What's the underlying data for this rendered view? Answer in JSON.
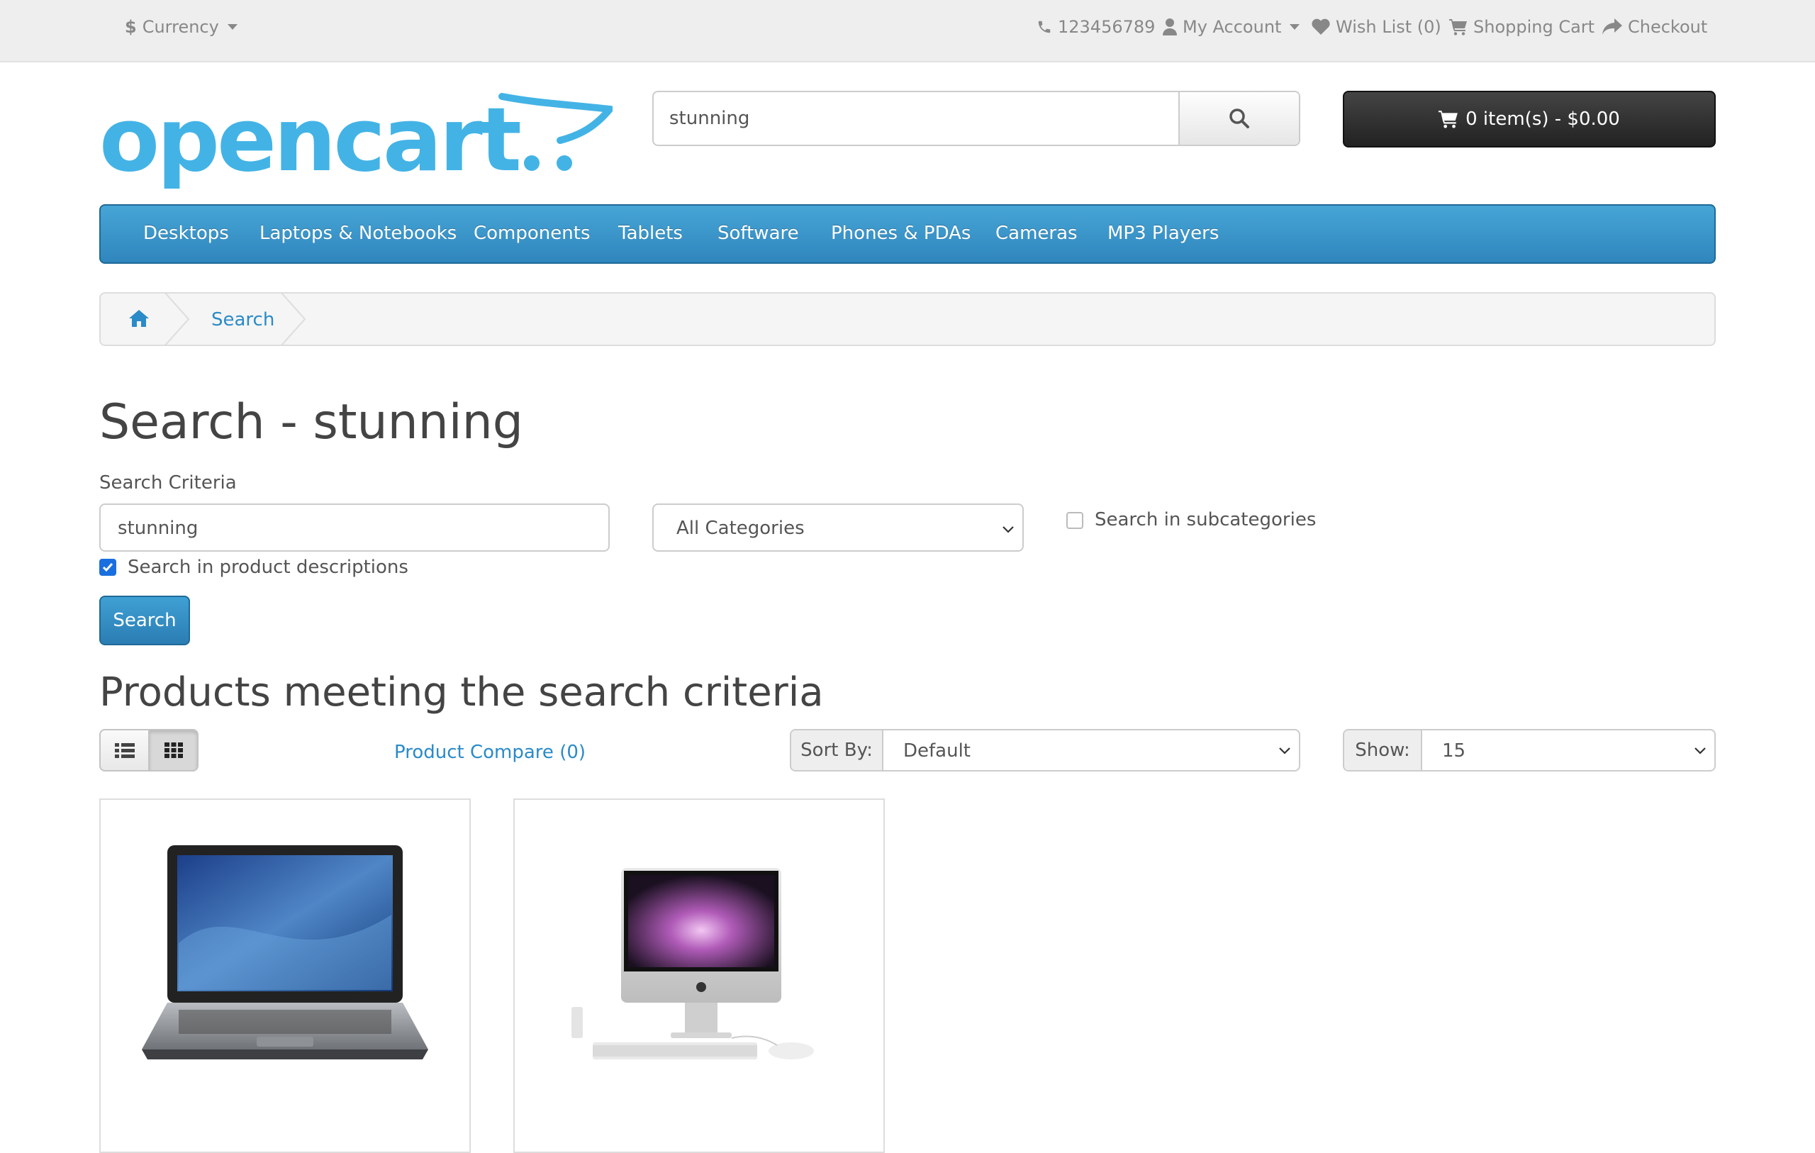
{
  "topbar": {
    "currency_symbol": "$",
    "currency_label": "Currency",
    "phone": "123456789",
    "my_account": "My Account",
    "wishlist": "Wish List (0)",
    "shopping_cart": "Shopping Cart",
    "checkout": "Checkout"
  },
  "header": {
    "logo_text": "opencart",
    "search_value": "stunning",
    "cart_label": "0 item(s) - $0.00"
  },
  "menu": {
    "items": [
      "Desktops",
      "Laptops & Notebooks",
      "Components",
      "Tablets",
      "Software",
      "Phones & PDAs",
      "Cameras",
      "MP3 Players"
    ]
  },
  "breadcrumb": {
    "current": "Search"
  },
  "page": {
    "title": "Search - stunning",
    "criteria_label": "Search Criteria",
    "keyword_value": "stunning",
    "category_selected": "All Categories",
    "subcategories_label": "Search in subcategories",
    "descriptions_label": "Search in product descriptions",
    "search_button": "Search",
    "results_heading": "Products meeting the search criteria",
    "product_compare": "Product Compare (0)",
    "sort_label": "Sort By:",
    "sort_value": "Default",
    "show_label": "Show:",
    "show_value": "15"
  },
  "colors": {
    "accent": "#2a8bc8",
    "menu_bg": "#3a95c9",
    "cart_bg": "#2b2b2b"
  }
}
